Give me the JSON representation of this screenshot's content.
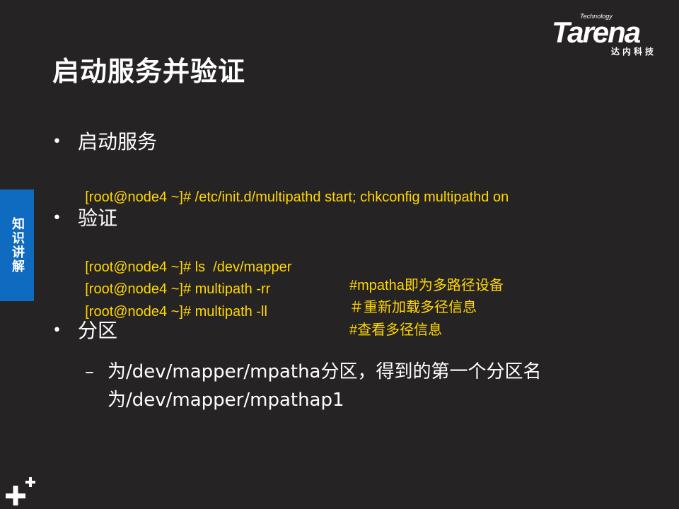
{
  "title": "启动服务并验证",
  "logo": {
    "tech": "Technology",
    "word": "Tarena",
    "sub": "达内科技"
  },
  "side_tab": {
    "label": "知识讲解"
  },
  "sections": [
    {
      "heading": "启动服务",
      "lines": [
        {
          "cmd": "[root@node4 ~]# /etc/init.d/multipathd start; chkconfig multipathd on",
          "comment": ""
        }
      ]
    },
    {
      "heading": "验证",
      "lines": [
        {
          "cmd": "[root@node4 ~]# ls  /dev/mapper",
          "comment": "#mpatha即为多路径设备"
        },
        {
          "cmd": "[root@node4 ~]# multipath -rr",
          "comment": "＃重新加载多径信息"
        },
        {
          "cmd": "[root@node4 ~]# multipath -ll",
          "comment": "#查看多径信息"
        }
      ]
    },
    {
      "heading": "分区",
      "sub": "为/dev/mapper/mpatha分区，得到的第一个分区名为/dev/mapper/mpathap1"
    }
  ],
  "colors": {
    "background": "#262324",
    "code": "#ffd700",
    "tab": "#0f6bbf"
  }
}
